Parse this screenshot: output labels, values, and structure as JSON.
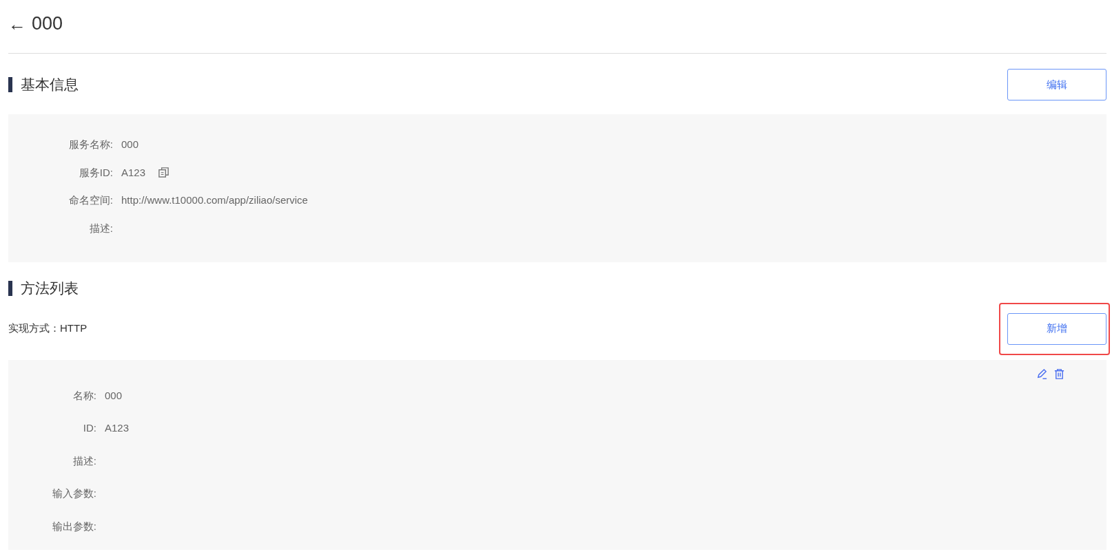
{
  "header": {
    "back": "←",
    "title": "000"
  },
  "basic_info": {
    "heading": "基本信息",
    "edit_button": "编辑",
    "fields": [
      {
        "label": "服务名称:",
        "value": "000"
      },
      {
        "label": "服务ID:",
        "value": "A123",
        "copyable": true
      },
      {
        "label": "命名空间:",
        "value": "http://www.t10000.com/app/ziliao/service"
      },
      {
        "label": "描述:"
      }
    ]
  },
  "methods": {
    "heading": "方法列表",
    "implementation": "实现方式：HTTP",
    "add_button": {
      "label": "新增",
      "highlighted": true
    },
    "items": [
      {
        "fields": [
          {
            "label": "名称:",
            "value": "000"
          },
          {
            "label": "ID:",
            "value": "A123"
          },
          {
            "label": "描述:"
          },
          {
            "label": "输入参数:"
          },
          {
            "label": "输出参数:"
          }
        ]
      }
    ]
  }
}
